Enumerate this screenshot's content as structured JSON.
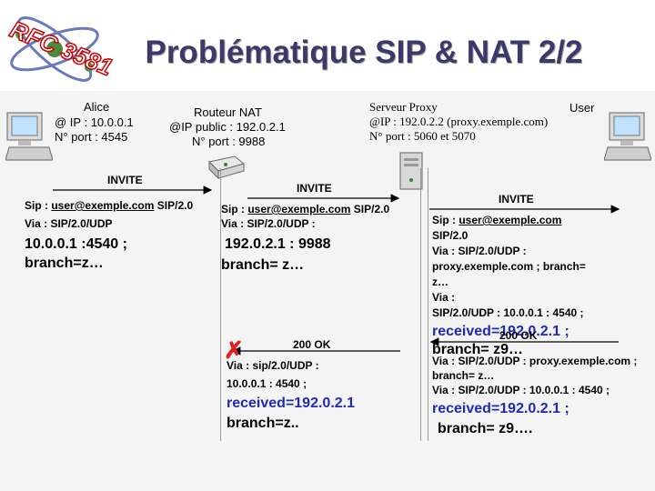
{
  "logo": {
    "text": "RFC 3581"
  },
  "slide": {
    "title": "Problématique SIP & NAT 2/2"
  },
  "nodes": {
    "alice": {
      "name": "Alice",
      "ip": "@ IP : 10.0.0.1",
      "port": "N° port : 4545"
    },
    "router": {
      "name": "Routeur NAT",
      "ip": "@IP public : 192.0.2.1",
      "port": "N° port : 9988"
    },
    "proxy": {
      "name": "Serveur Proxy",
      "ip": "@IP : 192.0.2.2 (proxy.exemple.com)",
      "port": "N° port : 5060 et 5070"
    },
    "user": {
      "name": "User"
    }
  },
  "msg1": {
    "label": "INVITE",
    "sip_prefix": "Sip : ",
    "sip_uri": "user@exemple.com",
    "sip_suffix": " SIP/2.0",
    "via": "Via : SIP/2.0/UDP",
    "big1": "10.0.0.1 :4540 ;",
    "big2": "branch=z…"
  },
  "msg2": {
    "label": "INVITE",
    "sip_prefix": "Sip : ",
    "sip_uri": "user@exemple.com",
    "sip_suffix": " SIP/2.0",
    "via": "Via : SIP/2.0/UDP :",
    "big1": "192.0.2.1 : 9988",
    "big2": "branch= z…"
  },
  "msg3": {
    "label": "INVITE",
    "sip_prefix": "Sip : ",
    "sip_uri": "user@exemple.com",
    "line2": "SIP/2.0",
    "line3": "Via : SIP/2.0/UDP :",
    "line4": "proxy.exemple.com ; branch=",
    "line5": "z…",
    "line6": "Via :",
    "line7": "SIP/2.0/UDP : 10.0.0.1 : 4540 ;",
    "big1": "received=192.0.2.1 ;",
    "big2": "branch= z9…"
  },
  "resp1": {
    "label": "200 OK",
    "line1": "Via : sip/2.0/UDP :",
    "line2": "10.0.0.1 : 4540 ;",
    "big1": "received=192.0.2.1",
    "big2": "branch=z.."
  },
  "resp2": {
    "label": "200 OK",
    "line1": "Via : SIP/2.0/UDP : proxy.exemple.com ;",
    "line2": "branch= z…",
    "line3": "Via : SIP/2.0/UDP : 10.0.0.1 : 4540 ;",
    "big1": "received=192.0.2.1 ;",
    "big2": "branch= z9…."
  },
  "colors": {
    "highlight": "#1f2ab8",
    "title": "#3a3a6a",
    "cross": "#e02020"
  }
}
